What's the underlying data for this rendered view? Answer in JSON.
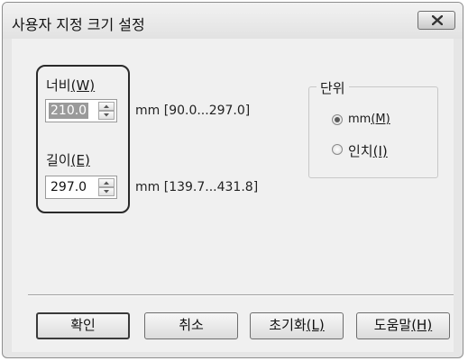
{
  "window": {
    "title": "사용자 지정 크기 설정",
    "close_icon": "close-icon"
  },
  "width": {
    "label": "너비",
    "mnemonic": "(W)",
    "value": "210.0",
    "range": "mm [90.0...297.0]"
  },
  "length": {
    "label": "길이",
    "mnemonic": "(E)",
    "value": "297.0",
    "range": "mm [139.7...431.8]"
  },
  "unit": {
    "legend": "단위",
    "options": [
      {
        "label": "mm",
        "mnemonic": "(M)",
        "checked": true
      },
      {
        "label": "인치",
        "mnemonic": "(I)",
        "checked": false
      }
    ]
  },
  "buttons": {
    "ok": "확인",
    "cancel": "취소",
    "reset": {
      "label": "초기화",
      "mnemonic": "(L)"
    },
    "help": {
      "label": "도움말",
      "mnemonic": "(H)"
    }
  }
}
